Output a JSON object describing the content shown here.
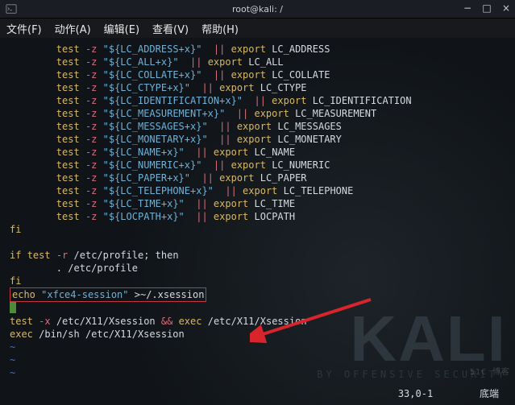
{
  "titlebar": {
    "app_icon": "terminal-icon",
    "title": "root@kali: /",
    "controls": {
      "minimize": "−",
      "maximize": "□",
      "close": "×"
    }
  },
  "menubar": {
    "items": [
      "文件(F)",
      "动作(A)",
      "编辑(E)",
      "查看(V)",
      "帮助(H)"
    ]
  },
  "vars": [
    "LC_ADDRESS",
    "LC_ALL",
    "LC_COLLATE",
    "LC_CTYPE",
    "LC_IDENTIFICATION",
    "LC_MEASUREMENT",
    "LC_MESSAGES",
    "LC_MONETARY",
    "LC_NAME",
    "LC_NUMERIC",
    "LC_PAPER",
    "LC_TELEPHONE",
    "LC_TIME",
    "LOCPATH"
  ],
  "code": {
    "fi1": "fi",
    "if_line_kw_if": "if",
    "if_line_kw_test": "test",
    "if_line_flag": "-r",
    "if_line_path": "/etc/profile",
    "if_line_then": "; then",
    "dot_line": "        . /etc/profile",
    "fi2": "fi",
    "echo_kw": "echo",
    "echo_str": "\"xfce4-session\"",
    "echo_rest": " >~/.xsession",
    "test_kw": "test",
    "test_flag": "-x",
    "test_path": "/etc/X11/Xsession",
    "and": "&&",
    "exec1_kw": "exec",
    "exec1_path": "/etc/X11/Xsession",
    "exec2_kw": "exec",
    "exec2_path": "/bin/sh /etc/X11/Xsession"
  },
  "tilde": "~",
  "status": {
    "position": "33,0-1",
    "label": "底端"
  },
  "watermark": {
    "logo": "KALI",
    "subtitle": "BY OFFENSIVE SECURITY"
  },
  "watermark2": "51C 博客"
}
